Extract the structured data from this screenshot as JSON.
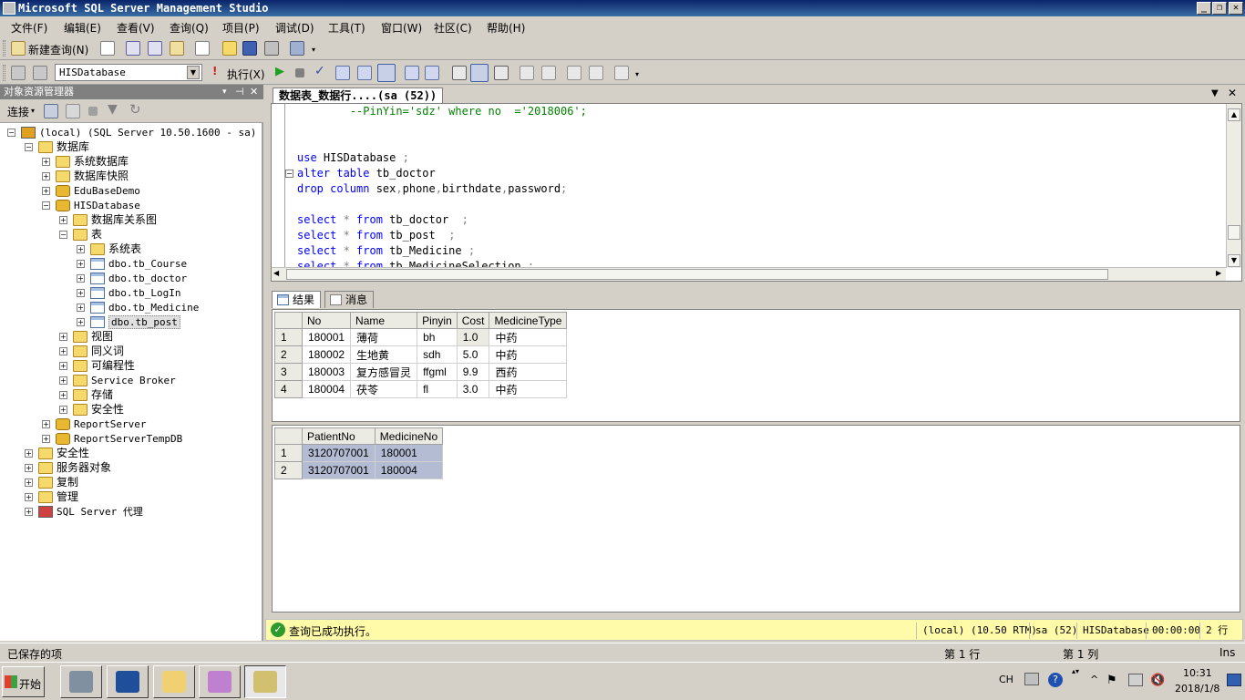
{
  "window": {
    "title": "Microsoft SQL Server Management Studio"
  },
  "menu": [
    "文件(F)",
    "编辑(E)",
    "查看(V)",
    "查询(Q)",
    "项目(P)",
    "调试(D)",
    "工具(T)",
    "窗口(W)",
    "社区(C)",
    "帮助(H)"
  ],
  "toolbar1": {
    "new_query": "新建查询(N)"
  },
  "toolbar2": {
    "database": "HISDatabase",
    "execute": "执行(X)"
  },
  "object_explorer": {
    "title": "对象资源管理器",
    "connect": "连接",
    "nodes": [
      "(local) (SQL Server 10.50.1600 - sa)",
      "数据库",
      "系统数据库",
      "数据库快照",
      "EduBaseDemo",
      "HISDatabase",
      "数据库关系图",
      "表",
      "系统表",
      "dbo.tb_Course",
      "dbo.tb_doctor",
      "dbo.tb_LogIn",
      "dbo.tb_Medicine",
      "dbo.tb_post",
      "视图",
      "同义词",
      "可编程性",
      "Service Broker",
      "存储",
      "安全性",
      "ReportServer",
      "ReportServerTempDB",
      "安全性",
      "服务器对象",
      "复制",
      "管理",
      "SQL Server 代理"
    ]
  },
  "editor": {
    "tab_title": "数据表_数据行....(sa (52))",
    "code_lines": [
      {
        "parts": [
          {
            "t": "        --PinYin='sdz' where no  ='2018006';",
            "c": "cm"
          }
        ]
      },
      {
        "parts": [
          {
            "t": "",
            "c": ""
          }
        ]
      },
      {
        "parts": [
          {
            "t": "",
            "c": ""
          }
        ]
      },
      {
        "parts": [
          {
            "t": "use ",
            "c": "kw"
          },
          {
            "t": "HISDatabase ",
            "c": ""
          },
          {
            "t": ";",
            "c": "gr"
          }
        ]
      },
      {
        "parts": [
          {
            "t": "alter table ",
            "c": "kw"
          },
          {
            "t": "tb_doctor",
            "c": ""
          }
        ]
      },
      {
        "parts": [
          {
            "t": "drop column ",
            "c": "kw"
          },
          {
            "t": "sex",
            "c": ""
          },
          {
            "t": ",",
            "c": "gr"
          },
          {
            "t": "phone",
            "c": ""
          },
          {
            "t": ",",
            "c": "gr"
          },
          {
            "t": "birthdate",
            "c": ""
          },
          {
            "t": ",",
            "c": "gr"
          },
          {
            "t": "password",
            "c": ""
          },
          {
            "t": ";",
            "c": "gr"
          }
        ]
      },
      {
        "parts": [
          {
            "t": "",
            "c": ""
          }
        ]
      },
      {
        "parts": [
          {
            "t": "select ",
            "c": "kw"
          },
          {
            "t": "* ",
            "c": "gr"
          },
          {
            "t": "from ",
            "c": "kw"
          },
          {
            "t": "tb_doctor  ",
            "c": ""
          },
          {
            "t": ";",
            "c": "gr"
          }
        ]
      },
      {
        "parts": [
          {
            "t": "select ",
            "c": "kw"
          },
          {
            "t": "* ",
            "c": "gr"
          },
          {
            "t": "from ",
            "c": "kw"
          },
          {
            "t": "tb_post  ",
            "c": ""
          },
          {
            "t": ";",
            "c": "gr"
          }
        ]
      },
      {
        "parts": [
          {
            "t": "select ",
            "c": "kw"
          },
          {
            "t": "* ",
            "c": "gr"
          },
          {
            "t": "from ",
            "c": "kw"
          },
          {
            "t": "tb_Medicine ",
            "c": ""
          },
          {
            "t": ";",
            "c": "gr"
          }
        ]
      },
      {
        "parts": [
          {
            "t": "select ",
            "c": "kw"
          },
          {
            "t": "* ",
            "c": "gr"
          },
          {
            "t": "from ",
            "c": "kw"
          },
          {
            "t": "tb_MedicineSelection ",
            "c": ""
          },
          {
            "t": ";",
            "c": "gr"
          }
        ]
      }
    ]
  },
  "results_tabs": {
    "results": "结果",
    "messages": "消息"
  },
  "grid1": {
    "columns": [
      "No",
      "Name",
      "Pinyin",
      "Cost",
      "MedicineType"
    ],
    "rows": [
      [
        "1",
        "180001",
        "薄荷",
        "bh",
        "1.0",
        "中药"
      ],
      [
        "2",
        "180002",
        "生地黄",
        "sdh",
        "5.0",
        "中药"
      ],
      [
        "3",
        "180003",
        "复方感冒灵",
        "ffgml",
        "9.9",
        "西药"
      ],
      [
        "4",
        "180004",
        "茯苓",
        "fl",
        "3.0",
        "中药"
      ]
    ]
  },
  "grid2": {
    "columns": [
      "PatientNo",
      "MedicineNo"
    ],
    "rows": [
      [
        "1",
        "3120707001",
        "180001"
      ],
      [
        "2",
        "3120707001",
        "180004"
      ]
    ]
  },
  "query_status": {
    "message": "查询已成功执行。",
    "server": "(local) (10.50 RTM)",
    "user": "sa (52)",
    "database": "HISDatabase",
    "elapsed": "00:00:00",
    "rows": "2 行"
  },
  "statusbar": {
    "left": "已保存的项",
    "line": "第 1 行",
    "col": "第 1 列",
    "mode": "Ins"
  },
  "taskbar": {
    "start": "开始",
    "lang": "CH",
    "time": "10:31",
    "date": "2018/1/8"
  },
  "colors": {
    "title_bar": "#0a246a",
    "status_yellow": "#fffba8",
    "selection": "#b4bcd4"
  }
}
